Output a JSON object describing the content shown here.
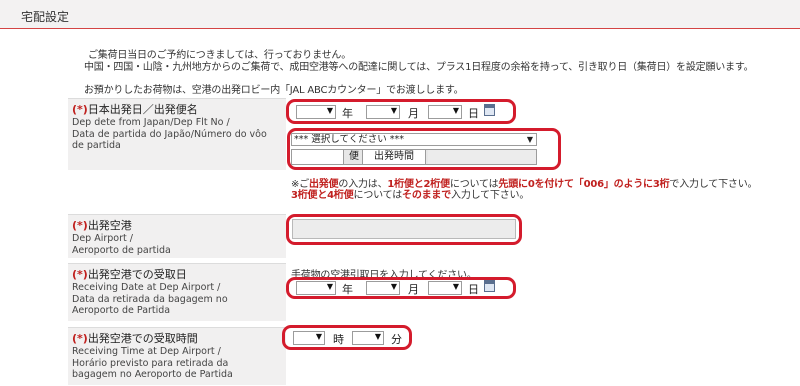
{
  "header": {
    "title": "宅配設定"
  },
  "notes": {
    "line1": "ご集荷日当日のご予約につきましては、行っておりません。",
    "line2": "中国・四国・山陰・九州地方からのご集荷で、成田空港等への配達に関しては、プラス1日程度の余裕を持って、引き取り日（集荷日）を設定願います。",
    "line3": "お預かりしたお荷物は、空港の出発ロビー内「JAL ABCカウンター」でお渡しします。"
  },
  "required_mark": "(*)",
  "field_departure": {
    "label_ja": "日本出発日／出発便名",
    "label_en_1": "Dep dete from Japan/Dep Flt No /",
    "label_en_2": "Data de partida do Japão/Número do vôo",
    "label_en_3": "de partida",
    "year_unit": "年",
    "month_unit": "月",
    "day_unit": "日",
    "flight_select_value": "*** 選択してください ***",
    "flight_suffix": "便",
    "departure_time_label": "出発時間"
  },
  "flight_note": {
    "line1_a": "※ご",
    "line1_b": "出発便",
    "line1_c": "の入力は、",
    "line1_d": "1桁便と2桁便",
    "line1_e": "については",
    "line1_f": "先頭に0を付けて「006」のように3桁",
    "line1_g": "で入力して下さい。",
    "line2_a": "3桁便と4桁便",
    "line2_b": "については",
    "line2_c": "そのままで",
    "line2_d": "入力して下さい。"
  },
  "field_airport": {
    "label_ja": "出発空港",
    "label_en_1": "Dep Airport /",
    "label_en_2": "Aeroporto de partida",
    "value": ""
  },
  "field_receiving_date": {
    "label_ja": "出発空港での受取日",
    "label_en_1": "Receiving Date at Dep Airport /",
    "label_en_2": "Data da retirada da bagagem no",
    "label_en_3": "Aeroporto de Partida",
    "hint": "手荷物の空港引取日を入力してください。",
    "year_unit": "年",
    "month_unit": "月",
    "day_unit": "日"
  },
  "field_receiving_time": {
    "label_ja": "出発空港での受取時間",
    "label_en_1": "Receiving Time at Dep Airport /",
    "label_en_2": "Horário previsto para retirada da",
    "label_en_3": "bagagem no Aeroporto de Partida",
    "hour_unit": "時",
    "minute_unit": "分"
  },
  "icons": {
    "dropdown": "▼",
    "calendar": "calendar-icon"
  },
  "colors": {
    "highlight": "#d41b2c",
    "required": "#c0201e",
    "header_rule": "#d34444"
  }
}
